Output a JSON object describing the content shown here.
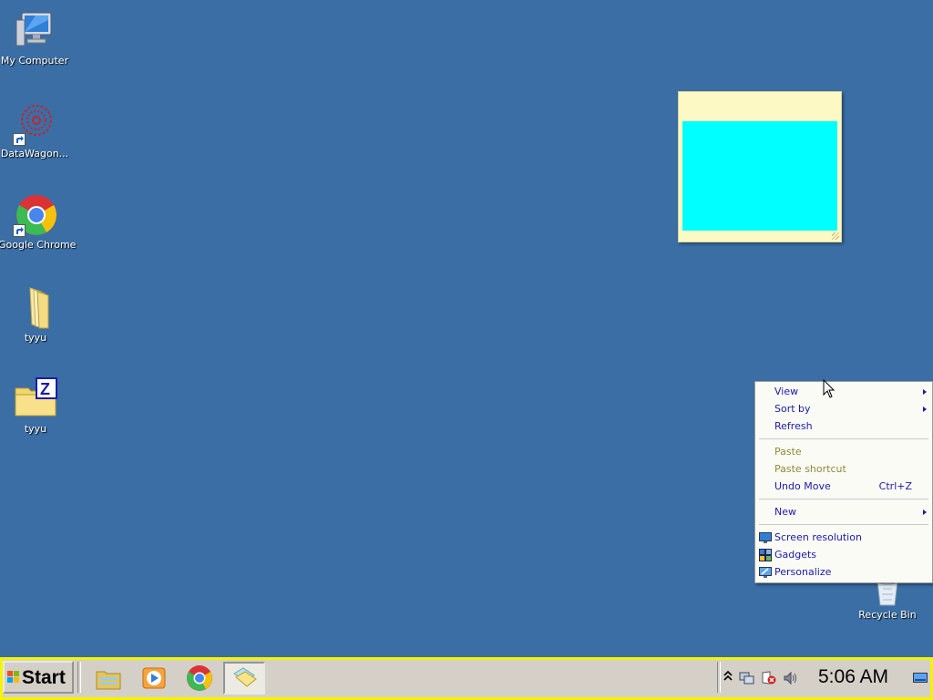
{
  "desktop_icons": [
    {
      "label": "My Computer",
      "icon": "computer-icon",
      "shortcut": false
    },
    {
      "label": "DataWagon...",
      "icon": "datawagon-icon",
      "shortcut": true
    },
    {
      "label": "Google Chrome",
      "icon": "chrome-icon",
      "shortcut": true
    },
    {
      "label": "tyyu",
      "icon": "folder-icon",
      "shortcut": false
    },
    {
      "label": "tyyu",
      "icon": "zip-folder-icon",
      "shortcut": false
    },
    {
      "label": "Recycle Bin",
      "icon": "recycle-bin-icon",
      "shortcut": false
    }
  ],
  "sticky_note": {
    "color": "#fdf9c5",
    "content_color": "#00ffff"
  },
  "context_menu": {
    "items": [
      {
        "label": "View",
        "submenu": true
      },
      {
        "label": "Sort by",
        "submenu": true
      },
      {
        "label": "Refresh"
      },
      {
        "label": "Paste",
        "disabled": true
      },
      {
        "label": "Paste shortcut",
        "disabled": true
      },
      {
        "label": "Undo Move",
        "shortcut": "Ctrl+Z"
      },
      {
        "label": "New",
        "submenu": true
      },
      {
        "label": "Screen resolution",
        "icon": "screen-resolution-icon"
      },
      {
        "label": "Gadgets",
        "icon": "gadgets-icon"
      },
      {
        "label": "Personalize",
        "icon": "personalize-icon"
      }
    ]
  },
  "taskbar": {
    "start_label": "Start",
    "apps": [
      "file-explorer-icon",
      "media-player-icon",
      "chrome-icon",
      "sticky-notes-icon"
    ],
    "active_app": "sticky-notes-icon",
    "clock": "5:06 AM",
    "colors": {
      "border": "#f4f400",
      "background": "#d4d0c8"
    }
  },
  "colors": {
    "desktop": "#3a6ea5",
    "menu_text": "#1a1aa8"
  }
}
